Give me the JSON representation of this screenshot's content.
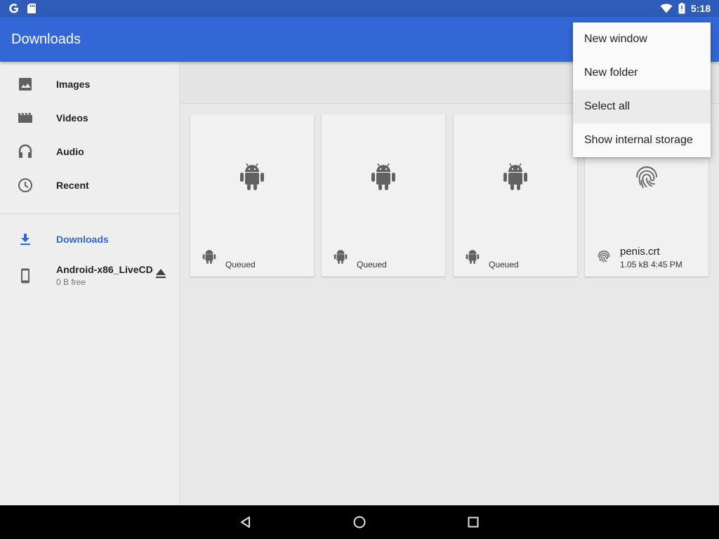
{
  "status_bar": {
    "time": "5:18",
    "icons": [
      "google-icon",
      "sd-card-icon",
      "wifi-icon",
      "battery-icon"
    ]
  },
  "app_bar": {
    "title": "Downloads",
    "color": "#3367d6"
  },
  "sidebar": {
    "items": [
      {
        "label": "Images",
        "icon": "image-icon"
      },
      {
        "label": "Videos",
        "icon": "video-icon"
      },
      {
        "label": "Audio",
        "icon": "audio-icon"
      },
      {
        "label": "Recent",
        "icon": "clock-icon"
      }
    ],
    "roots": [
      {
        "label": "Downloads",
        "icon": "download-icon",
        "active": true
      },
      {
        "label": "Android-x86_LiveCD",
        "sub": "0 B free",
        "icon": "phone-icon",
        "action_icon": "eject-icon"
      }
    ]
  },
  "files": [
    {
      "status": "Queued",
      "icon": "android-icon"
    },
    {
      "status": "Queued",
      "icon": "android-icon"
    },
    {
      "status": "Queued",
      "icon": "android-icon"
    },
    {
      "name": "penis.crt",
      "meta": "1.05 kB 4:45 PM",
      "icon": "fingerprint-icon"
    }
  ],
  "menu": {
    "items": [
      {
        "label": "New window"
      },
      {
        "label": "New folder"
      },
      {
        "label": "Select all",
        "highlighted": true
      },
      {
        "label": "Show internal storage"
      }
    ]
  },
  "nav_bar": {
    "buttons": [
      "back-icon",
      "home-icon",
      "recents-icon"
    ]
  }
}
